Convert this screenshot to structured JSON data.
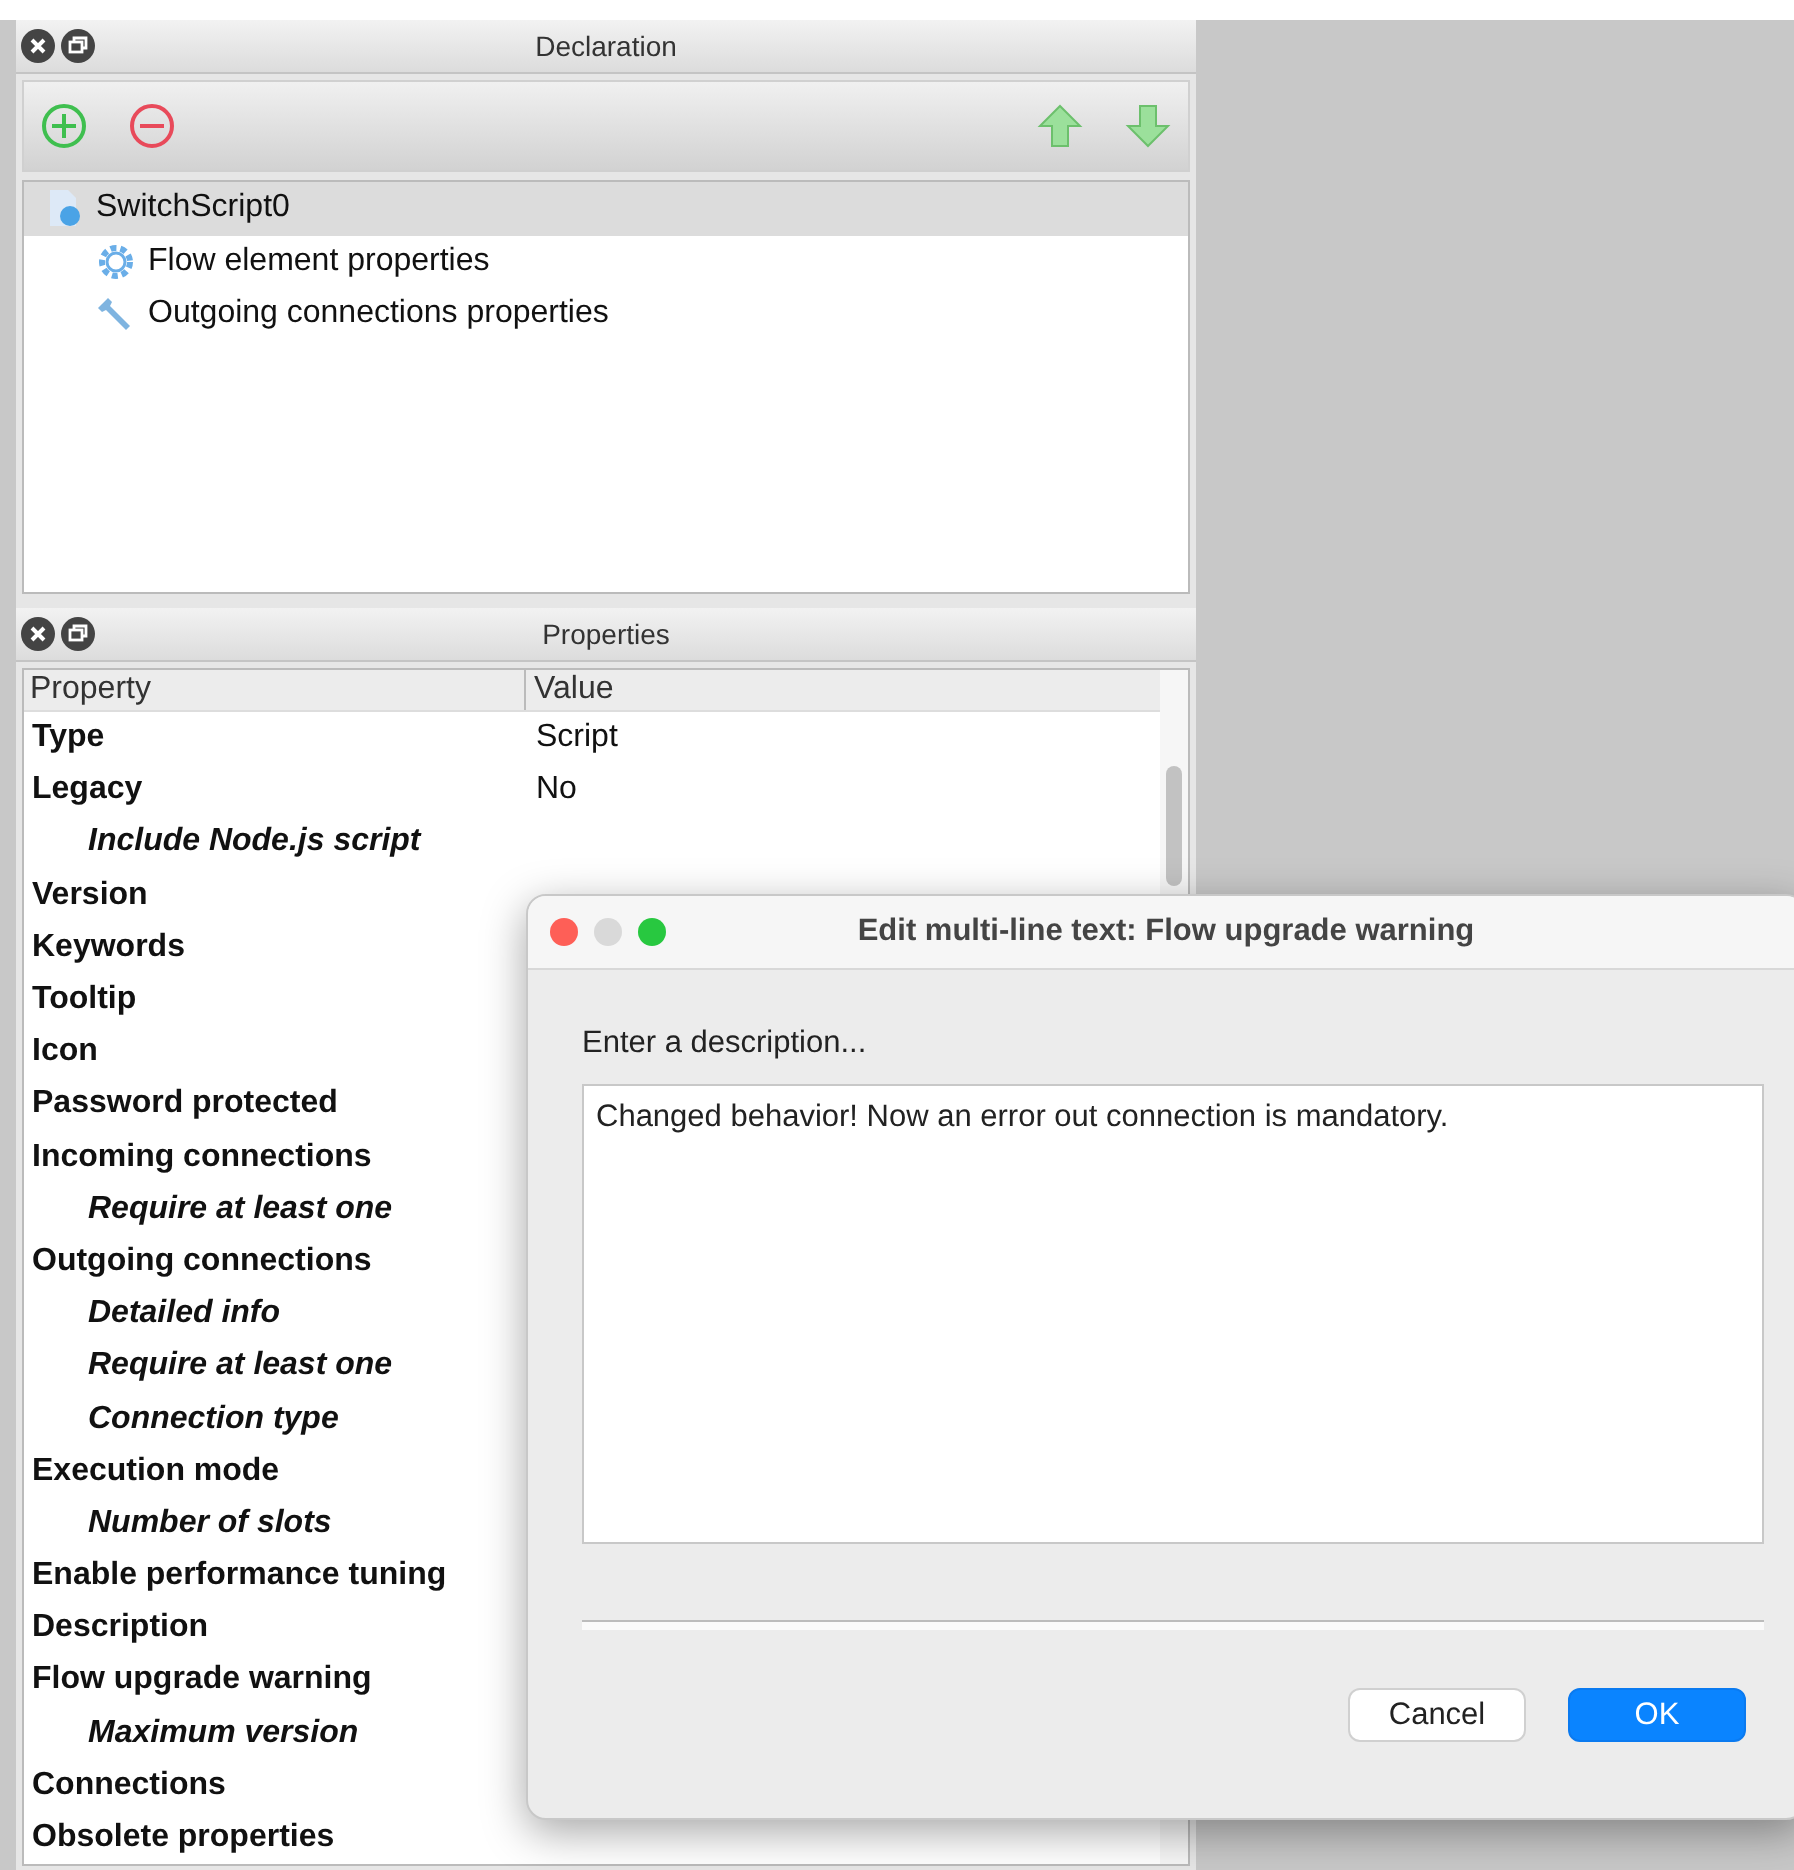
{
  "declaration": {
    "title": "Declaration",
    "tree": [
      {
        "label": "SwitchScript0",
        "selected": true,
        "children": [
          {
            "label": "Flow element properties",
            "kind": "gear",
            "selected": false
          },
          {
            "label": "Outgoing connections properties",
            "kind": "wrench",
            "selected": false
          }
        ]
      }
    ]
  },
  "properties": {
    "title": "Properties",
    "columns": [
      "Property",
      "Value"
    ],
    "rows": [
      {
        "name": "Type",
        "value": "Script"
      },
      {
        "name": "Legacy",
        "value": "No",
        "children": [
          {
            "name": "Include Node.js script"
          }
        ]
      },
      {
        "name": "Version"
      },
      {
        "name": "Keywords"
      },
      {
        "name": "Tooltip"
      },
      {
        "name": "Icon"
      },
      {
        "name": "Password protected"
      },
      {
        "name": "Incoming connections",
        "children": [
          {
            "name": "Require at least one"
          }
        ]
      },
      {
        "name": "Outgoing connections",
        "children": [
          {
            "name": "Detailed info"
          },
          {
            "name": "Require at least one"
          },
          {
            "name": "Connection type"
          }
        ]
      },
      {
        "name": "Execution mode",
        "children": [
          {
            "name": "Number of slots"
          }
        ]
      },
      {
        "name": "Enable performance tuning"
      },
      {
        "name": "Description"
      },
      {
        "name": "Flow upgrade warning",
        "children": [
          {
            "name": "Maximum version"
          }
        ]
      },
      {
        "name": "Connections"
      },
      {
        "name": "Obsolete properties"
      }
    ]
  },
  "dialog": {
    "title": "Edit multi-line text: Flow upgrade warning",
    "label": "Enter a description...",
    "value": "Changed behavior! Now an error out connection is mandatory.",
    "buttons": [
      {
        "label": "Cancel",
        "default": false
      },
      {
        "label": "OK",
        "default": true
      }
    ]
  }
}
